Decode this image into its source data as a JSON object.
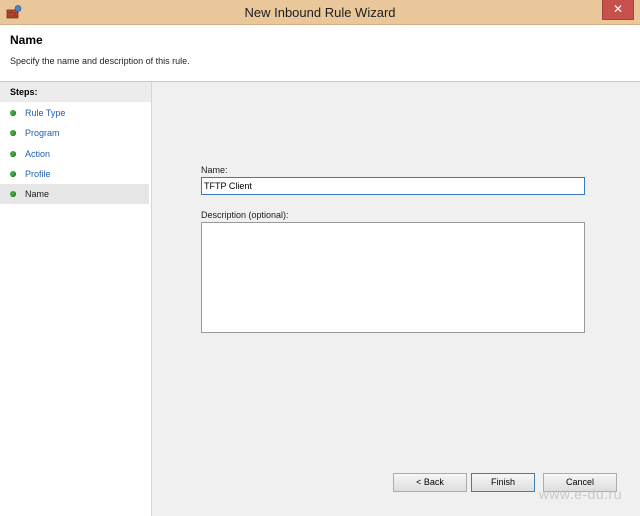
{
  "window": {
    "title": "New Inbound Rule Wizard",
    "close_label": "✕",
    "app_icon": "firewall-wizard-icon"
  },
  "header": {
    "title": "Name",
    "subtitle": "Specify the name and description of this rule."
  },
  "steps": {
    "title": "Steps:",
    "items": [
      {
        "label": "Rule Type",
        "active": false
      },
      {
        "label": "Program",
        "active": false
      },
      {
        "label": "Action",
        "active": false
      },
      {
        "label": "Profile",
        "active": false
      },
      {
        "label": "Name",
        "active": true
      }
    ]
  },
  "form": {
    "name_label": "Name:",
    "name_value": "TFTP Client",
    "description_label": "Description (optional):",
    "description_value": ""
  },
  "buttons": {
    "back": "< Back",
    "finish": "Finish",
    "cancel": "Cancel"
  },
  "watermark": "www.e-du.ru",
  "colors": {
    "titlebar": "#e9c79a",
    "step_dot": "#3fa441",
    "step_link": "#1f5fb1",
    "close_button": "#c7504c"
  }
}
